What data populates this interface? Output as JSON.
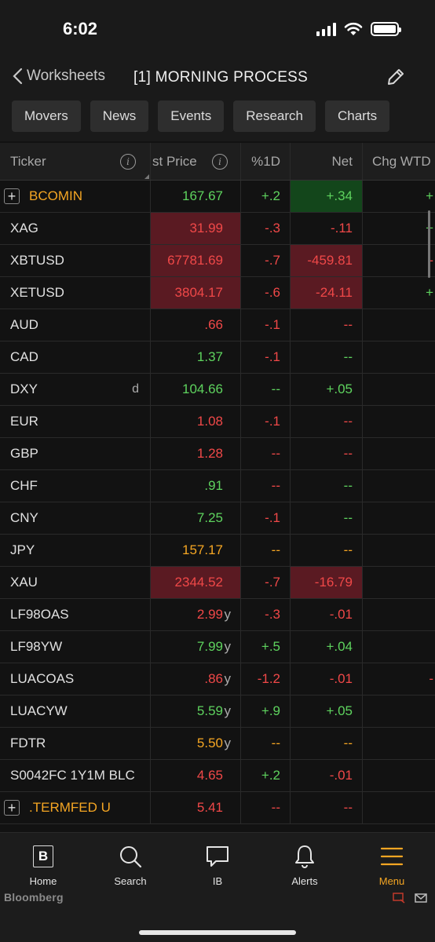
{
  "status": {
    "time": "6:02"
  },
  "nav": {
    "back_label": "Worksheets",
    "title": "[1] MORNING PROCESS"
  },
  "tabs": [
    "Movers",
    "News",
    "Events",
    "Research",
    "Charts"
  ],
  "columns": {
    "ticker": "Ticker",
    "price": "st Price",
    "pct": "%1D",
    "net": "Net",
    "wtd": "Chg WTD"
  },
  "rows": [
    {
      "ticker": "BCOMIN",
      "tickerColor": "orange",
      "expand": true,
      "suffix": "",
      "price": "167.67",
      "priceColor": "green",
      "priceBg": "",
      "priceSuffix": "",
      "pct": "+.2",
      "pctColor": "green",
      "net": "+.34",
      "netColor": "green",
      "netBg": "green",
      "wtd": "+",
      "wtdColor": "green"
    },
    {
      "ticker": "XAG",
      "tickerColor": "white",
      "expand": false,
      "suffix": "",
      "price": "31.99",
      "priceColor": "red",
      "priceBg": "red",
      "priceSuffix": "",
      "pct": "-.3",
      "pctColor": "red",
      "net": "-.11",
      "netColor": "red",
      "netBg": "",
      "wtd": "+",
      "wtdColor": "green"
    },
    {
      "ticker": "XBTUSD",
      "tickerColor": "white",
      "expand": false,
      "suffix": "",
      "price": "67781.69",
      "priceColor": "red",
      "priceBg": "red",
      "priceSuffix": "",
      "pct": "-.7",
      "pctColor": "red",
      "net": "-459.81",
      "netColor": "red",
      "netBg": "red",
      "wtd": "-",
      "wtdColor": "red"
    },
    {
      "ticker": "XETUSD",
      "tickerColor": "white",
      "expand": false,
      "suffix": "",
      "price": "3804.17",
      "priceColor": "red",
      "priceBg": "red",
      "priceSuffix": "",
      "pct": "-.6",
      "pctColor": "red",
      "net": "-24.11",
      "netColor": "red",
      "netBg": "red",
      "wtd": "+",
      "wtdColor": "green"
    },
    {
      "ticker": "AUD",
      "tickerColor": "white",
      "expand": false,
      "suffix": "",
      "price": ".66",
      "priceColor": "red",
      "priceBg": "",
      "priceSuffix": "",
      "pct": "-.1",
      "pctColor": "red",
      "net": "--",
      "netColor": "red",
      "netBg": "",
      "wtd": "",
      "wtdColor": ""
    },
    {
      "ticker": "CAD",
      "tickerColor": "white",
      "expand": false,
      "suffix": "",
      "price": "1.37",
      "priceColor": "green",
      "priceBg": "",
      "priceSuffix": "",
      "pct": "-.1",
      "pctColor": "red",
      "net": "--",
      "netColor": "green",
      "netBg": "",
      "wtd": "",
      "wtdColor": ""
    },
    {
      "ticker": "DXY",
      "tickerColor": "white",
      "expand": false,
      "suffix": "d",
      "price": "104.66",
      "priceColor": "green",
      "priceBg": "",
      "priceSuffix": "",
      "pct": "--",
      "pctColor": "green",
      "net": "+.05",
      "netColor": "green",
      "netBg": "",
      "wtd": "",
      "wtdColor": ""
    },
    {
      "ticker": "EUR",
      "tickerColor": "white",
      "expand": false,
      "suffix": "",
      "price": "1.08",
      "priceColor": "red",
      "priceBg": "",
      "priceSuffix": "",
      "pct": "-.1",
      "pctColor": "red",
      "net": "--",
      "netColor": "red",
      "netBg": "",
      "wtd": "",
      "wtdColor": ""
    },
    {
      "ticker": "GBP",
      "tickerColor": "white",
      "expand": false,
      "suffix": "",
      "price": "1.28",
      "priceColor": "red",
      "priceBg": "",
      "priceSuffix": "",
      "pct": "--",
      "pctColor": "red",
      "net": "--",
      "netColor": "red",
      "netBg": "",
      "wtd": "",
      "wtdColor": ""
    },
    {
      "ticker": "CHF",
      "tickerColor": "white",
      "expand": false,
      "suffix": "",
      "price": ".91",
      "priceColor": "green",
      "priceBg": "",
      "priceSuffix": "",
      "pct": "--",
      "pctColor": "red",
      "net": "--",
      "netColor": "green",
      "netBg": "",
      "wtd": "",
      "wtdColor": ""
    },
    {
      "ticker": "CNY",
      "tickerColor": "white",
      "expand": false,
      "suffix": "",
      "price": "7.25",
      "priceColor": "green",
      "priceBg": "",
      "priceSuffix": "",
      "pct": "-.1",
      "pctColor": "red",
      "net": "--",
      "netColor": "green",
      "netBg": "",
      "wtd": "",
      "wtdColor": ""
    },
    {
      "ticker": "JPY",
      "tickerColor": "white",
      "expand": false,
      "suffix": "",
      "price": "157.17",
      "priceColor": "orange",
      "priceBg": "",
      "priceSuffix": "",
      "pct": "--",
      "pctColor": "orange",
      "net": "--",
      "netColor": "orange",
      "netBg": "",
      "wtd": "",
      "wtdColor": ""
    },
    {
      "ticker": "XAU",
      "tickerColor": "white",
      "expand": false,
      "suffix": "",
      "price": "2344.52",
      "priceColor": "red",
      "priceBg": "red",
      "priceSuffix": "",
      "pct": "-.7",
      "pctColor": "red",
      "net": "-16.79",
      "netColor": "red",
      "netBg": "red",
      "wtd": "",
      "wtdColor": ""
    },
    {
      "ticker": "LF98OAS",
      "tickerColor": "white",
      "expand": false,
      "suffix": "",
      "price": "2.99",
      "priceColor": "red",
      "priceBg": "",
      "priceSuffix": "y",
      "pct": "-.3",
      "pctColor": "red",
      "net": "-.01",
      "netColor": "red",
      "netBg": "",
      "wtd": "",
      "wtdColor": ""
    },
    {
      "ticker": "LF98YW",
      "tickerColor": "white",
      "expand": false,
      "suffix": "",
      "price": "7.99",
      "priceColor": "green",
      "priceBg": "",
      "priceSuffix": "y",
      "pct": "+.5",
      "pctColor": "green",
      "net": "+.04",
      "netColor": "green",
      "netBg": "",
      "wtd": "",
      "wtdColor": ""
    },
    {
      "ticker": "LUACOAS",
      "tickerColor": "white",
      "expand": false,
      "suffix": "",
      "price": ".86",
      "priceColor": "red",
      "priceBg": "",
      "priceSuffix": "y",
      "pct": "-1.2",
      "pctColor": "red",
      "net": "-.01",
      "netColor": "red",
      "netBg": "",
      "wtd": "-",
      "wtdColor": "red"
    },
    {
      "ticker": "LUACYW",
      "tickerColor": "white",
      "expand": false,
      "suffix": "",
      "price": "5.59",
      "priceColor": "green",
      "priceBg": "",
      "priceSuffix": "y",
      "pct": "+.9",
      "pctColor": "green",
      "net": "+.05",
      "netColor": "green",
      "netBg": "",
      "wtd": "",
      "wtdColor": ""
    },
    {
      "ticker": "FDTR",
      "tickerColor": "white",
      "expand": false,
      "suffix": "",
      "price": "5.50",
      "priceColor": "orange",
      "priceBg": "",
      "priceSuffix": "y",
      "pct": "--",
      "pctColor": "orange",
      "net": "--",
      "netColor": "orange",
      "netBg": "",
      "wtd": "",
      "wtdColor": ""
    },
    {
      "ticker": "S0042FC 1Y1M BLC",
      "tickerColor": "white",
      "expand": false,
      "suffix": "",
      "price": "4.65",
      "priceColor": "red",
      "priceBg": "",
      "priceSuffix": "",
      "pct": "+.2",
      "pctColor": "green",
      "net": "-.01",
      "netColor": "red",
      "netBg": "",
      "wtd": "",
      "wtdColor": ""
    },
    {
      "ticker": ".TERMFED U",
      "tickerColor": "orange",
      "expand": true,
      "suffix": "",
      "price": "5.41",
      "priceColor": "red",
      "priceBg": "",
      "priceSuffix": "",
      "pct": "--",
      "pctColor": "red",
      "net": "--",
      "netColor": "red",
      "netBg": "",
      "wtd": "",
      "wtdColor": ""
    }
  ],
  "bottom_nav": [
    {
      "label": "Home",
      "icon": "bloomberg-b-icon"
    },
    {
      "label": "Search",
      "icon": "search-icon"
    },
    {
      "label": "IB",
      "icon": "chat-bubble-icon"
    },
    {
      "label": "Alerts",
      "icon": "bell-icon"
    },
    {
      "label": "Menu",
      "icon": "menu-icon",
      "active": true
    }
  ],
  "brand": "Bloomberg",
  "colors": {
    "green": "#5ed35e",
    "red": "#f04848",
    "orange": "#f5a623",
    "bg_red": "#5a1a22",
    "bg_green": "#13461b"
  }
}
